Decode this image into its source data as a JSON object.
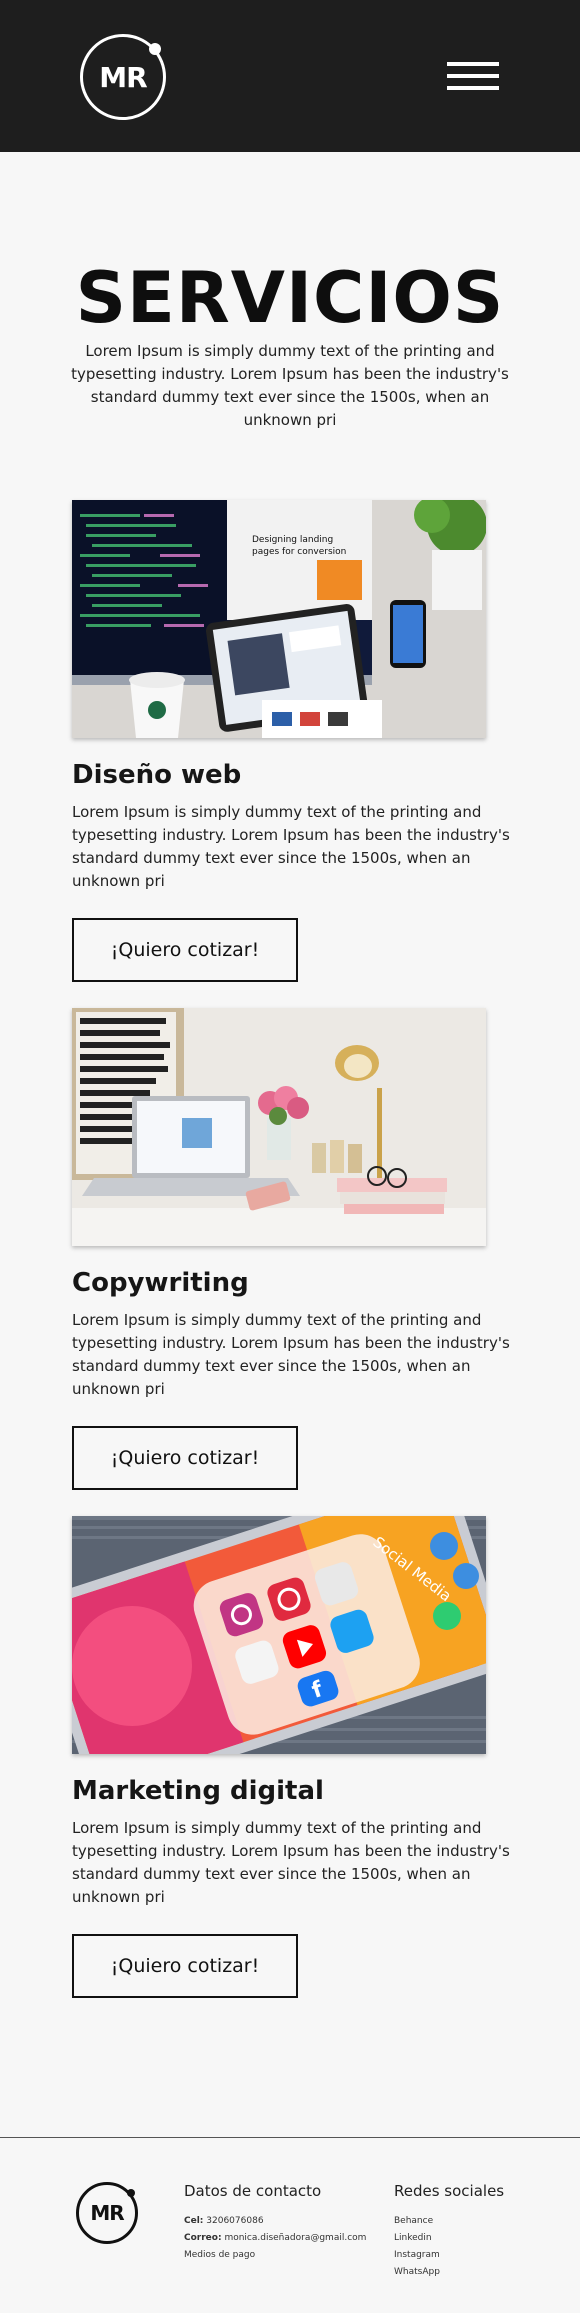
{
  "header": {
    "logo_text": "MR",
    "menu_icon": "hamburger-menu-icon"
  },
  "hero": {
    "title": "SERVICIOS",
    "text": "Lorem Ipsum is simply dummy text of the printing and typesetting industry. Lorem Ipsum has been the industry's standard dummy text ever since the 1500s, when an unknown pri"
  },
  "services": [
    {
      "title": "Diseño web",
      "text": "Lorem Ipsum is simply dummy text of the printing and typesetting industry. Lorem Ipsum has been the industry's standard dummy text ever since the 1500s, when an unknown pri",
      "button": "¡Quiero cotizar!"
    },
    {
      "title": "Copywriting",
      "text": "Lorem Ipsum is simply dummy text of the printing and typesetting industry. Lorem Ipsum has been the industry's standard dummy text ever since the 1500s, when an unknown pri",
      "button": "¡Quiero cotizar!"
    },
    {
      "title": "Marketing digital",
      "text": "Lorem Ipsum is simply dummy text of the printing and typesetting industry. Lorem Ipsum has been the industry's standard dummy text ever since the 1500s, when an unknown pri",
      "button": "¡Quiero cotizar!"
    }
  ],
  "footer": {
    "logo_text": "MR",
    "contact": {
      "title": "Datos de contacto",
      "phone_label": "Cel:",
      "phone": "3206076086",
      "email_label": "Correo:",
      "email": "monica.diseñadora@gmail.com",
      "payment": "Medios de pago"
    },
    "social": {
      "title": "Redes sociales",
      "links": [
        "Behance",
        "Linkedin",
        "Instagram",
        "WhatsApp"
      ]
    }
  }
}
